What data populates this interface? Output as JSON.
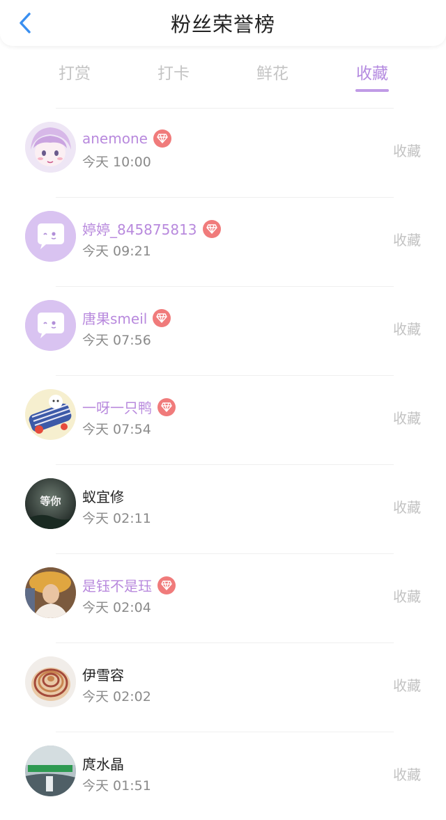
{
  "header": {
    "title": "粉丝荣誉榜"
  },
  "tabs": [
    {
      "label": "打赏",
      "active": false
    },
    {
      "label": "打卡",
      "active": false
    },
    {
      "label": "鲜花",
      "active": false
    },
    {
      "label": "收藏",
      "active": true
    }
  ],
  "colors": {
    "accent": "#b889dd",
    "badge": "#f07b7b",
    "back_icon": "#3a8ff0"
  },
  "rows": [
    {
      "name": "anemone",
      "vip": true,
      "time": "今天 10:00",
      "action": "收藏",
      "avatar": "anime-girl-avatar"
    },
    {
      "name": "婷婷_845875813",
      "vip": true,
      "time": "今天 09:21",
      "action": "收藏",
      "avatar": "default-chat-bubble-avatar"
    },
    {
      "name": "唐果smeil",
      "vip": true,
      "time": "今天 07:56",
      "action": "收藏",
      "avatar": "default-chat-bubble-avatar"
    },
    {
      "name": "一呀一只鸭",
      "vip": true,
      "time": "今天 07:54",
      "action": "收藏",
      "avatar": "cartoon-cat-avatar"
    },
    {
      "name": "蚁宜修",
      "vip": false,
      "time": "今天 02:11",
      "action": "收藏",
      "avatar": "photo-avatar-dark",
      "avatar_text": "等你"
    },
    {
      "name": "是钰不是珏",
      "vip": true,
      "time": "今天 02:04",
      "action": "收藏",
      "avatar": "photo-avatar-person"
    },
    {
      "name": "伊雪容",
      "vip": false,
      "time": "今天 02:02",
      "action": "收藏",
      "avatar": "seashell-avatar"
    },
    {
      "name": "庹水晶",
      "vip": false,
      "time": "今天 01:51",
      "action": "收藏",
      "avatar": "photo-avatar-green-text"
    }
  ]
}
